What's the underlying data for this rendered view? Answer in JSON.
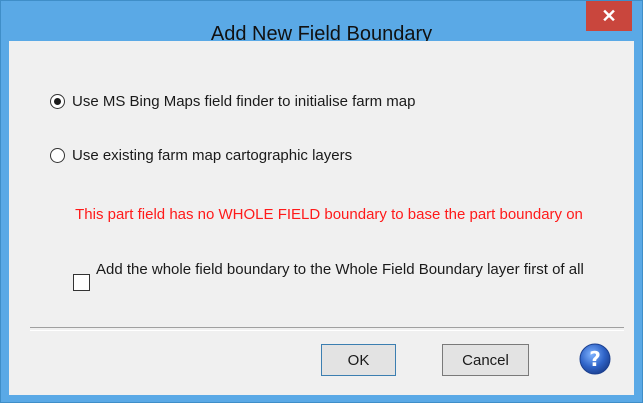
{
  "window": {
    "title": "Add New Field Boundary",
    "close_glyph": "✕"
  },
  "options": [
    {
      "label": "Use MS Bing Maps field finder to initialise farm map",
      "selected": true
    },
    {
      "label": "Use existing farm map cartographic layers",
      "selected": false
    }
  ],
  "warning": {
    "text": "This part field has no WHOLE FIELD boundary to base the part boundary on",
    "color": "#ff1a1a"
  },
  "checkbox": {
    "label": "Add the whole field boundary to the Whole Field Boundary layer first of all",
    "checked": false
  },
  "buttons": {
    "ok_label": "OK",
    "cancel_label": "Cancel"
  },
  "icons": {
    "help": "help-icon",
    "close": "close-icon"
  },
  "colors": {
    "titlebar": "#5aa9e6",
    "close": "#c9463d",
    "help": "#2f63c7"
  }
}
